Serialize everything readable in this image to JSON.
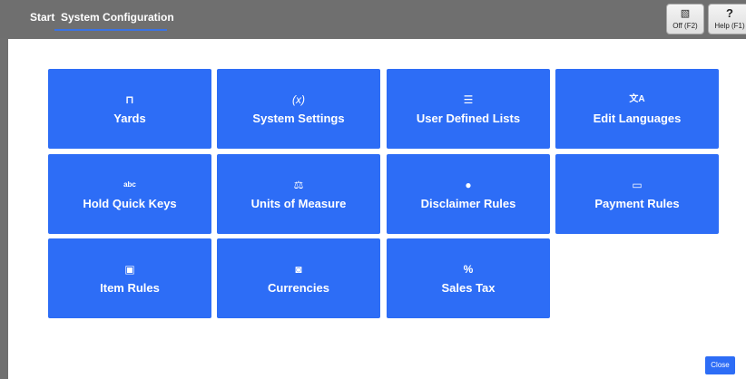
{
  "header": {
    "tab_start": "Start",
    "tab_config": "System Configuration",
    "off_button": {
      "icon": "no-video-icon",
      "glyph": "▧",
      "label": "Off (F2)"
    },
    "help_button": {
      "icon": "question-icon",
      "glyph": "?",
      "label": "Help (F1)"
    }
  },
  "tiles": [
    {
      "label": "Yards",
      "icon": "yard-icon",
      "glyph": "⊓"
    },
    {
      "label": "System Settings",
      "icon": "variable-icon",
      "glyph": "(x)"
    },
    {
      "label": "User Defined Lists",
      "icon": "list-icon",
      "glyph": "☰"
    },
    {
      "label": "Edit Languages",
      "icon": "translate-icon",
      "glyph": "文A"
    },
    {
      "label": "Hold Quick Keys",
      "icon": "abc-icon",
      "glyph": "abc"
    },
    {
      "label": "Units of Measure",
      "icon": "scale-icon",
      "glyph": "⚖"
    },
    {
      "label": "Disclaimer Rules",
      "icon": "alert-icon",
      "glyph": "●"
    },
    {
      "label": "Payment Rules",
      "icon": "credit-card-icon",
      "glyph": "▭"
    },
    {
      "label": "Item Rules",
      "icon": "ticket-icon",
      "glyph": "▣"
    },
    {
      "label": "Currencies",
      "icon": "money-icon",
      "glyph": "◙"
    },
    {
      "label": "Sales Tax",
      "icon": "percent-icon",
      "glyph": "%"
    }
  ],
  "footer": {
    "close_label": "Close"
  },
  "colors": {
    "accent": "#2d6df6",
    "topbar": "#6f6f6f",
    "background": "#ffffff"
  }
}
